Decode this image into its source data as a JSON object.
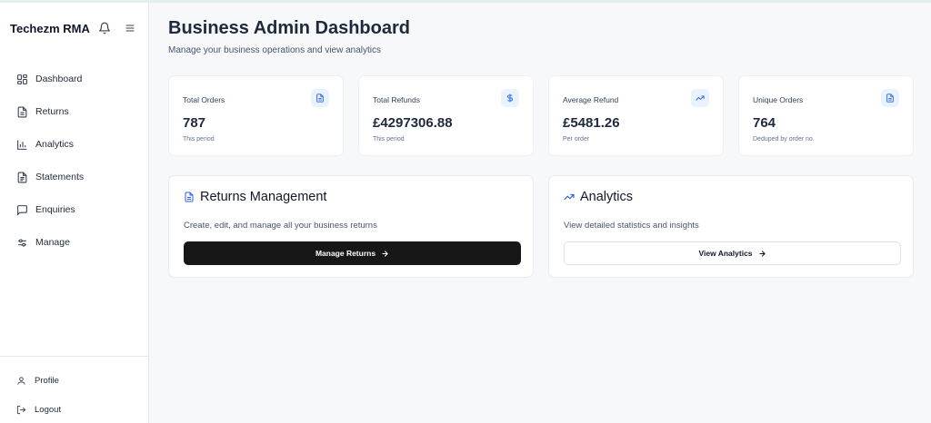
{
  "sidebar": {
    "brand": "Techezm RMA",
    "items": [
      {
        "label": "Dashboard",
        "icon": "dashboard-grid-icon"
      },
      {
        "label": "Returns",
        "icon": "document-icon"
      },
      {
        "label": "Analytics",
        "icon": "bar-chart-icon"
      },
      {
        "label": "Statements",
        "icon": "statement-icon"
      },
      {
        "label": "Enquiries",
        "icon": "message-icon"
      },
      {
        "label": "Manage",
        "icon": "sliders-icon"
      }
    ],
    "footer": [
      {
        "label": "Profile",
        "icon": "user-icon"
      },
      {
        "label": "Logout",
        "icon": "logout-icon"
      }
    ]
  },
  "header": {
    "title": "Business Admin Dashboard",
    "subtitle": "Manage your business operations and view analytics"
  },
  "stats": [
    {
      "label": "Total Orders",
      "value": "787",
      "note": "This period",
      "icon": "document-icon"
    },
    {
      "label": "Total Refunds",
      "value": "£4297306.88",
      "note": "This period",
      "icon": "dollar-icon"
    },
    {
      "label": "Average Refund",
      "value": "£5481.26",
      "note": "Per order",
      "icon": "trending-up-icon"
    },
    {
      "label": "Unique Orders",
      "value": "764",
      "note": "Deduped by order no.",
      "icon": "document-icon"
    }
  ],
  "panels": {
    "returns": {
      "title": "Returns Management",
      "description": "Create, edit, and manage all your business returns",
      "button": "Manage Returns"
    },
    "analytics": {
      "title": "Analytics",
      "description": "View detailed statistics and insights",
      "button": "View Analytics"
    }
  },
  "colors": {
    "accent": "#2563eb",
    "dark_button": "#171717",
    "background": "#f7f8fa"
  }
}
